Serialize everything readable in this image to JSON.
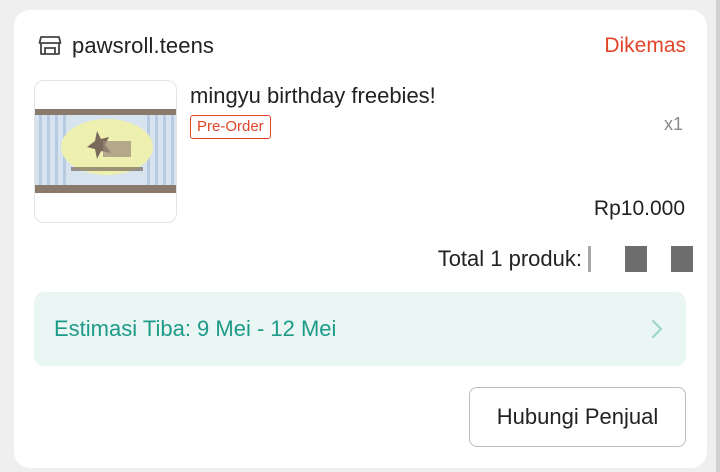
{
  "order": {
    "shop_name": "pawsroll.teens",
    "shop_icon": "storefront-icon",
    "status": "Dikemas",
    "status_color": "#e0452a"
  },
  "product": {
    "title": "mingyu birthday freebies!",
    "badge": "Pre-Order",
    "quantity": "x1",
    "price": "Rp10.000",
    "thumbnail": "product-thumbnail-banner"
  },
  "summary": {
    "total_label": "Total 1 produk:"
  },
  "estimate": {
    "text": "Estimasi Tiba: 9 Mei - 12 Mei",
    "color": "#1e9a88",
    "icon": "chevron-right-icon"
  },
  "actions": {
    "contact_seller": "Hubungi Penjual"
  }
}
